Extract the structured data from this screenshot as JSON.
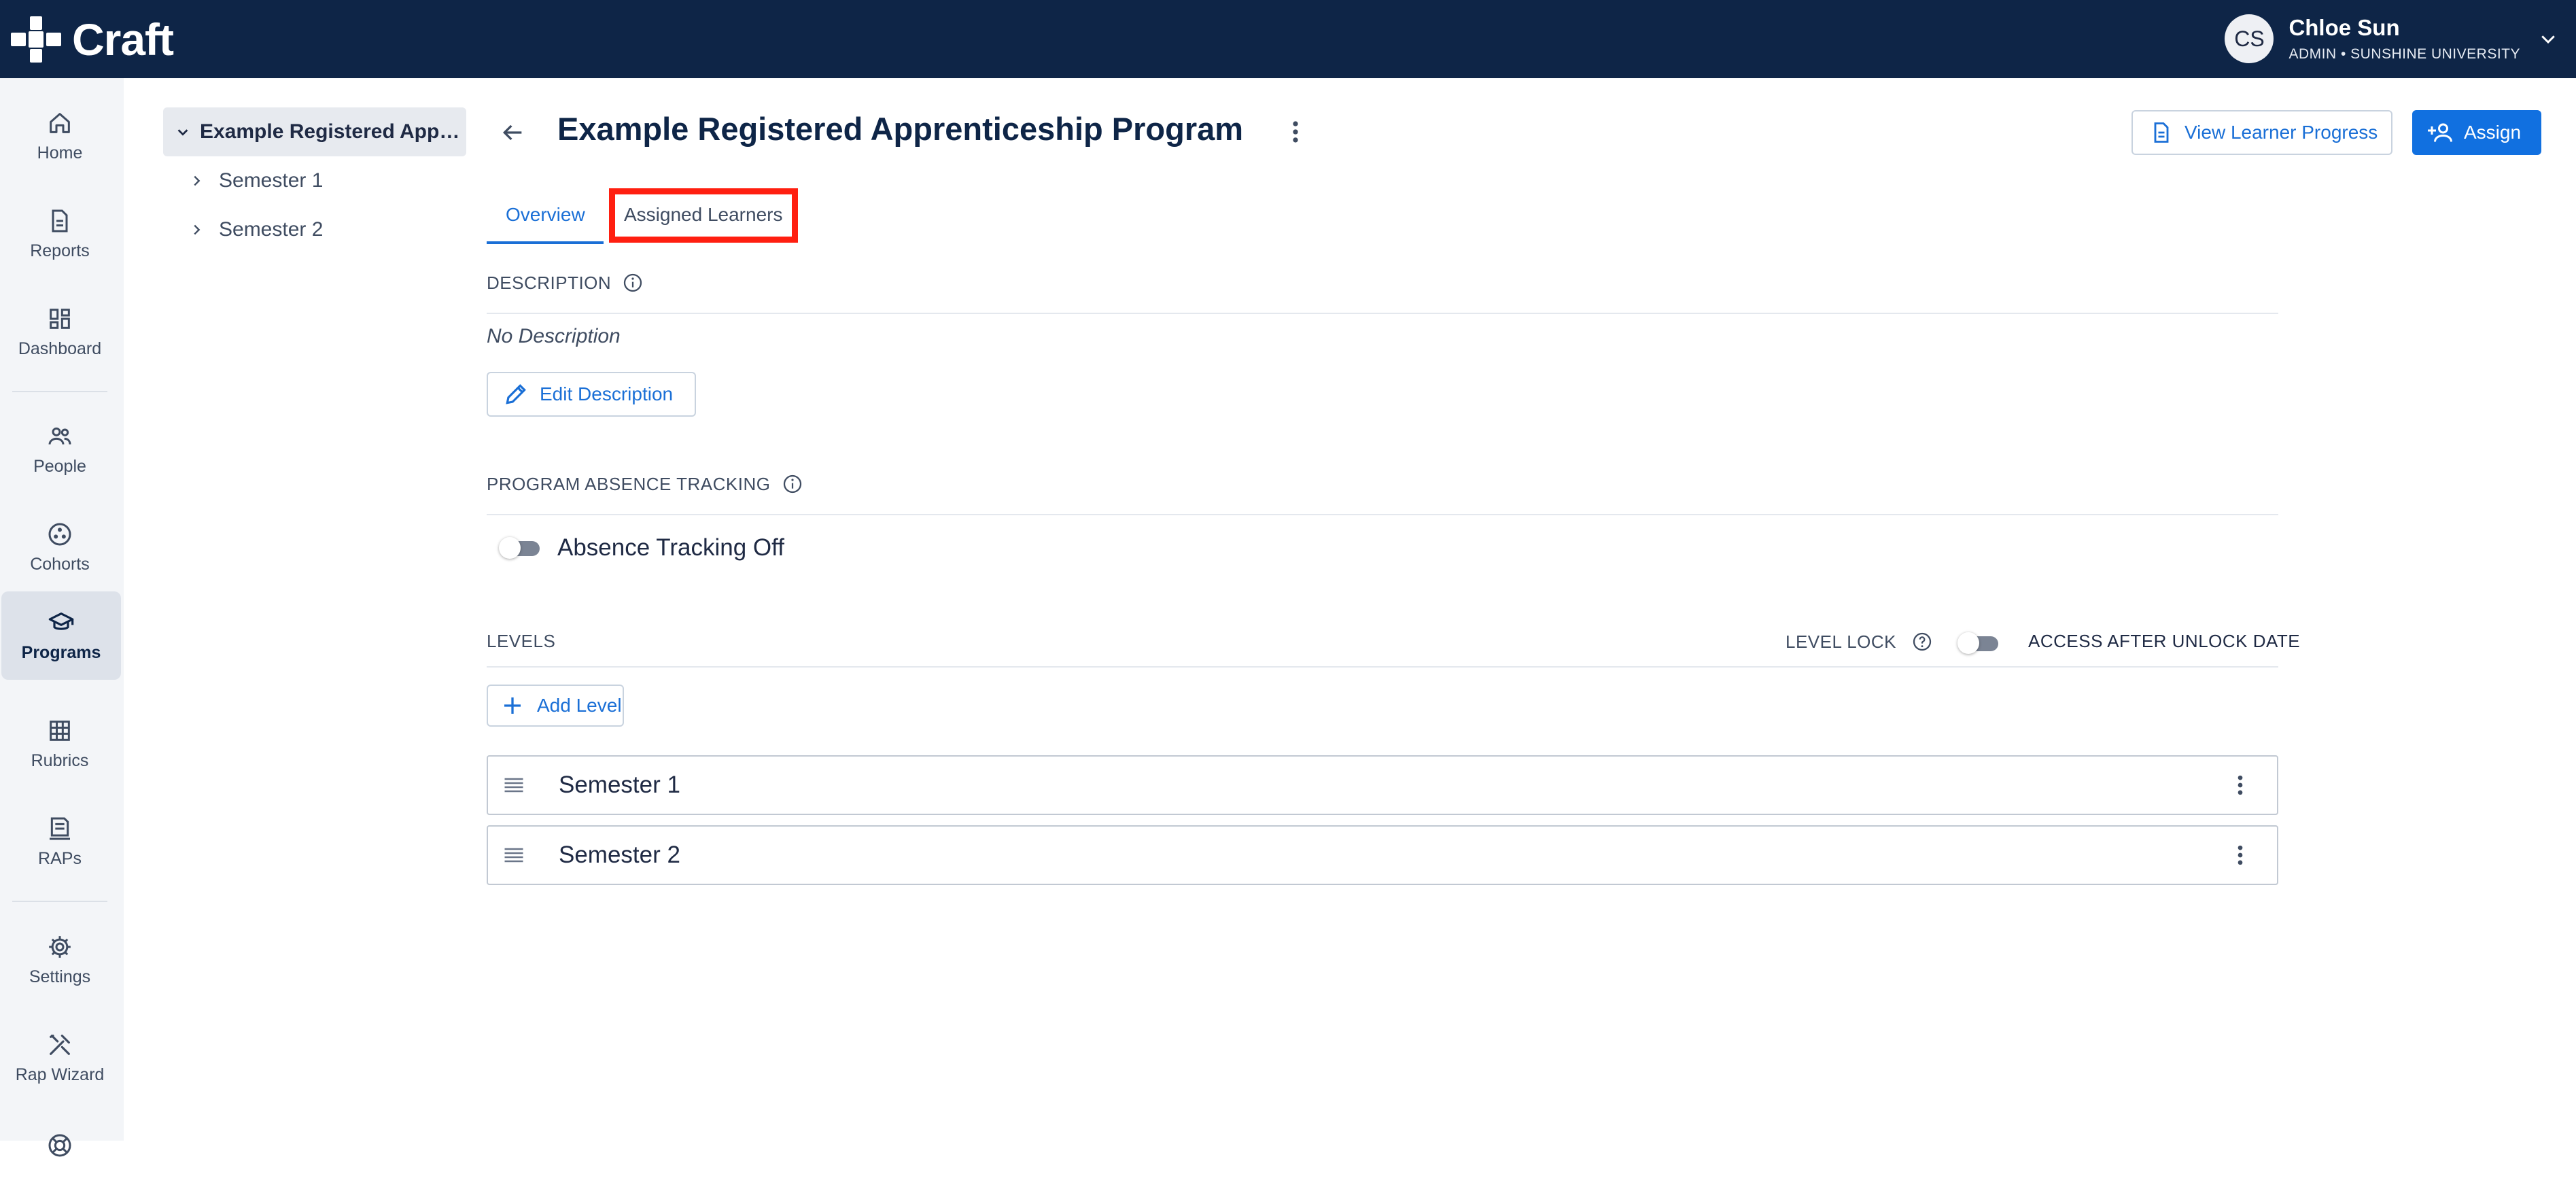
{
  "app": {
    "name": "Craft"
  },
  "user": {
    "initials": "CS",
    "name": "Chloe Sun",
    "org": "ADMIN • SUNSHINE UNIVERSITY"
  },
  "nav": {
    "items": [
      {
        "label": "Home",
        "icon": "home-icon"
      },
      {
        "label": "Reports",
        "icon": "document-icon"
      },
      {
        "label": "Dashboard",
        "icon": "dashboard-icon"
      },
      {
        "label": "People",
        "icon": "people-icon"
      },
      {
        "label": "Cohorts",
        "icon": "cohorts-icon"
      },
      {
        "label": "Programs",
        "icon": "graduation-cap-icon",
        "active": true
      },
      {
        "label": "Rubrics",
        "icon": "grid-icon"
      },
      {
        "label": "RAPs",
        "icon": "certificate-icon"
      },
      {
        "label": "Settings",
        "icon": "gear-icon"
      },
      {
        "label": "Rap Wizard",
        "icon": "tools-icon"
      }
    ]
  },
  "tree": {
    "root": "Example Registered Apprenticeship Program",
    "children": [
      "Semester 1",
      "Semester 2"
    ]
  },
  "header": {
    "title": "Example Registered Apprenticeship Program",
    "view_progress_label": "View Learner Progress",
    "assign_label": "Assign"
  },
  "tabs": [
    {
      "label": "Overview",
      "active": true
    },
    {
      "label": "Assigned Learners",
      "active": false
    }
  ],
  "description": {
    "heading": "DESCRIPTION",
    "value": "No Description",
    "edit_label": "Edit Description"
  },
  "absence": {
    "heading": "PROGRAM ABSENCE TRACKING",
    "toggle_label": "Absence Tracking Off",
    "enabled": false
  },
  "levels": {
    "heading": "LEVELS",
    "lock_label": "LEVEL LOCK",
    "access_label": "ACCESS AFTER UNLOCK DATE",
    "lock_enabled": false,
    "add_label": "Add Level",
    "items": [
      "Semester 1",
      "Semester 2"
    ]
  },
  "colors": {
    "topbar": "#0e2547",
    "accent": "#1170e0",
    "highlight": "#ff1f10"
  }
}
